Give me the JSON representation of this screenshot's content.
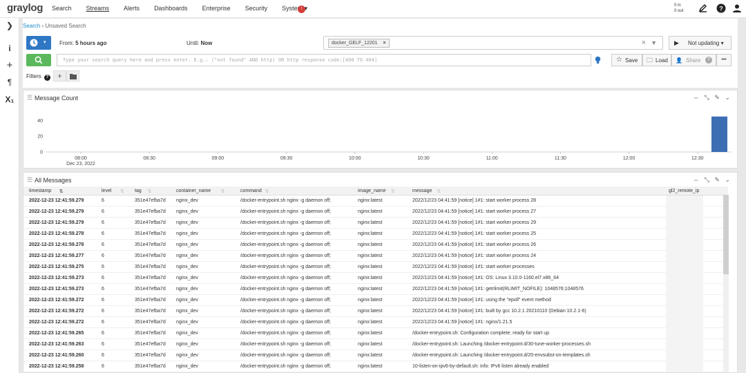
{
  "nav": {
    "logo": "graylog",
    "links": [
      "Search",
      "Streams",
      "Alerts",
      "Dashboards",
      "Enterprise",
      "Security",
      "System ▾"
    ],
    "badge": "!",
    "in_out": [
      "0 in",
      "0 out"
    ]
  },
  "breadcrumb": {
    "search": "Search",
    "sep": " › ",
    "current": "Unsaved Search"
  },
  "timerange": {
    "from_label": "From:",
    "from_value": "5 hours ago",
    "until_label": "Until:",
    "until_value": "Now"
  },
  "stream": {
    "tag": "docker_GELF_12201",
    "tag_remove": "×",
    "clear": "×"
  },
  "refresh": {
    "label": "Not updating ▾"
  },
  "query": {
    "placeholder": "Type your search query here and press enter. E.g.: (\"not found\" AND http) OR http response code:[400 TO 404]"
  },
  "actions": {
    "save": "Save",
    "load": "Load",
    "share": "Share",
    "more": "•••"
  },
  "filters": {
    "label": "Filters"
  },
  "message_count": {
    "title": "Message Count",
    "y_ticks": [
      "40",
      "20",
      "0"
    ],
    "x_ticks": [
      "08:00",
      "08:30",
      "09:00",
      "09:30",
      "10:00",
      "10:30",
      "11:00",
      "11:30",
      "12:00",
      "12:30"
    ],
    "x_sub": "Dec 23, 2022",
    "bar_value": 45,
    "bar_color": "#3c6eb4"
  },
  "all_messages": {
    "title": "All Messages",
    "columns": [
      "timestamp",
      "level",
      "tag",
      "container_name",
      "command",
      "image_name",
      "message",
      "gl2_remote_ip"
    ],
    "rows": [
      [
        "2022-12-23 12:41:59.279",
        "6",
        "351e47efba7d",
        "nginx_dev",
        "/docker-entrypoint.sh nginx -g daemon off;",
        "nginx:latest",
        "2022/12/23 04:41:59 [notice] 1#1: start worker process 28"
      ],
      [
        "2022-12-23 12:41:59.279",
        "6",
        "351e47efba7d",
        "nginx_dev",
        "/docker-entrypoint.sh nginx -g daemon off;",
        "nginx:latest",
        "2022/12/23 04:41:59 [notice] 1#1: start worker process 27"
      ],
      [
        "2022-12-23 12:41:59.279",
        "6",
        "351e47efba7d",
        "nginx_dev",
        "/docker-entrypoint.sh nginx -g daemon off;",
        "nginx:latest",
        "2022/12/23 04:41:59 [notice] 1#1: start worker process 29"
      ],
      [
        "2022-12-23 12:41:59.278",
        "6",
        "351e47efba7d",
        "nginx_dev",
        "/docker-entrypoint.sh nginx -g daemon off;",
        "nginx:latest",
        "2022/12/23 04:41:59 [notice] 1#1: start worker process 25"
      ],
      [
        "2022-12-23 12:41:59.278",
        "6",
        "351e47efba7d",
        "nginx_dev",
        "/docker-entrypoint.sh nginx -g daemon off;",
        "nginx:latest",
        "2022/12/23 04:41:59 [notice] 1#1: start worker process 26"
      ],
      [
        "2022-12-23 12:41:59.277",
        "6",
        "351e47efba7d",
        "nginx_dev",
        "/docker-entrypoint.sh nginx -g daemon off;",
        "nginx:latest",
        "2022/12/23 04:41:59 [notice] 1#1: start worker process 24"
      ],
      [
        "2022-12-23 12:41:59.275",
        "6",
        "351e47efba7d",
        "nginx_dev",
        "/docker-entrypoint.sh nginx -g daemon off;",
        "nginx:latest",
        "2022/12/23 04:41:59 [notice] 1#1: start worker processes"
      ],
      [
        "2022-12-23 12:41:59.273",
        "6",
        "351e47efba7d",
        "nginx_dev",
        "/docker-entrypoint.sh nginx -g daemon off;",
        "nginx:latest",
        "2022/12/23 04:41:59 [notice] 1#1: OS: Linux 3.10.0-1160.el7.x86_64"
      ],
      [
        "2022-12-23 12:41:59.273",
        "6",
        "351e47efba7d",
        "nginx_dev",
        "/docker-entrypoint.sh nginx -g daemon off;",
        "nginx:latest",
        "2022/12/23 04:41:59 [notice] 1#1: getrlimit(RLIMIT_NOFILE): 1048576:1048576"
      ],
      [
        "2022-12-23 12:41:59.272",
        "6",
        "351e47efba7d",
        "nginx_dev",
        "/docker-entrypoint.sh nginx -g daemon off;",
        "nginx:latest",
        "2022/12/23 04:41:59 [notice] 1#1: using the \"epoll\" event method"
      ],
      [
        "2022-12-23 12:41:59.272",
        "6",
        "351e47efba7d",
        "nginx_dev",
        "/docker-entrypoint.sh nginx -g daemon off;",
        "nginx:latest",
        "2022/12/23 04:41:59 [notice] 1#1: built by gcc 10.2.1 20210110 (Debian 10.2.1-6)"
      ],
      [
        "2022-12-23 12:41:59.272",
        "6",
        "351e47efba7d",
        "nginx_dev",
        "/docker-entrypoint.sh nginx -g daemon off;",
        "nginx:latest",
        "2022/12/23 04:41:59 [notice] 1#1: nginx/1.21.5"
      ],
      [
        "2022-12-23 12:41:59.265",
        "6",
        "351e47efba7d",
        "nginx_dev",
        "/docker-entrypoint.sh nginx -g daemon off;",
        "nginx:latest",
        "/docker-entrypoint.sh: Configuration complete; ready for start up"
      ],
      [
        "2022-12-23 12:41:59.263",
        "6",
        "351e47efba7d",
        "nginx_dev",
        "/docker-entrypoint.sh nginx -g daemon off;",
        "nginx:latest",
        "/docker-entrypoint.sh: Launching /docker-entrypoint.d/30-tune-worker-processes.sh"
      ],
      [
        "2022-12-23 12:41:59.260",
        "6",
        "351e47efba7d",
        "nginx_dev",
        "/docker-entrypoint.sh nginx -g daemon off;",
        "nginx:latest",
        "/docker-entrypoint.sh: Launching /docker-entrypoint.d/20-envsubst-on-templates.sh"
      ],
      [
        "2022-12-23 12:41:59.258",
        "6",
        "351e47efba7d",
        "nginx_dev",
        "/docker-entrypoint.sh nginx -g daemon off;",
        "nginx:latest",
        "10-listen-on-ipv6-by-default.sh: info: IPv6 listen already enabled"
      ]
    ]
  }
}
